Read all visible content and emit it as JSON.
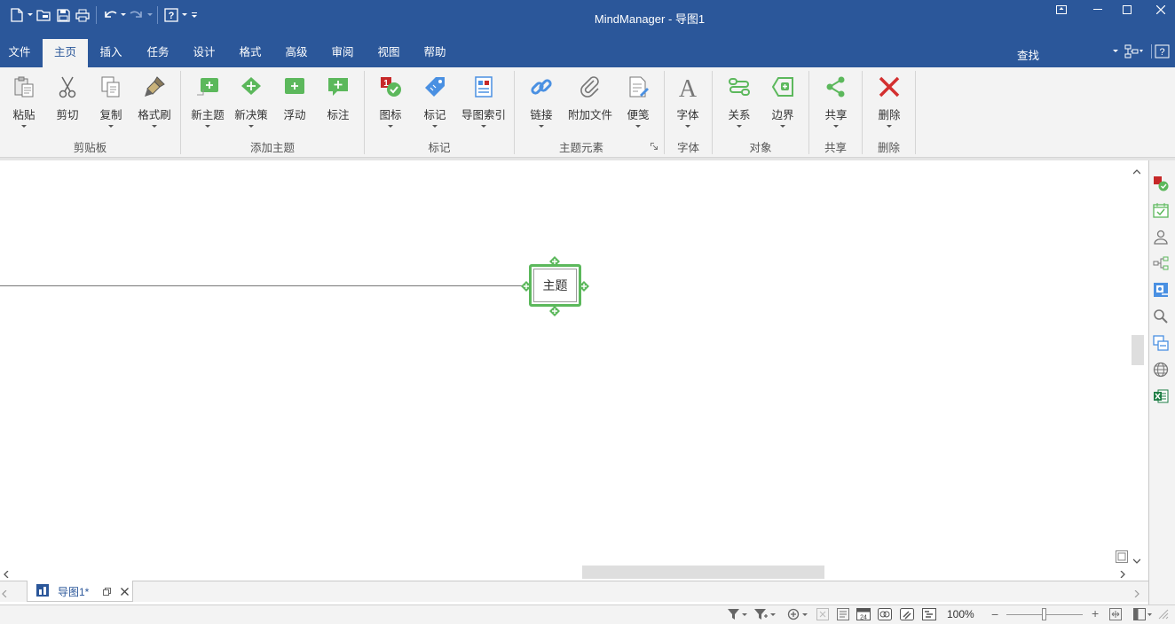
{
  "app": {
    "title": "MindManager - 导图1"
  },
  "quick_access": {
    "icons": [
      "new-doc-icon",
      "open-icon",
      "save-icon",
      "print-icon",
      "undo-icon",
      "redo-icon",
      "help-icon",
      "customize-icon"
    ]
  },
  "tabs": [
    {
      "label": "文件"
    },
    {
      "label": "主页",
      "active": true
    },
    {
      "label": "插入"
    },
    {
      "label": "任务"
    },
    {
      "label": "设计"
    },
    {
      "label": "格式"
    },
    {
      "label": "高级"
    },
    {
      "label": "审阅"
    },
    {
      "label": "视图"
    },
    {
      "label": "帮助"
    }
  ],
  "search": {
    "label": "查找"
  },
  "ribbon": {
    "groups": [
      {
        "label": "剪贴板",
        "buttons": [
          "粘贴",
          "剪切",
          "复制",
          "格式刷"
        ]
      },
      {
        "label": "添加主题",
        "buttons": [
          "新主题",
          "新决策",
          "浮动",
          "标注"
        ]
      },
      {
        "label": "标记",
        "buttons": [
          "图标",
          "标记",
          "导图索引"
        ]
      },
      {
        "label": "主题元素",
        "buttons": [
          "链接",
          "附加文件",
          "便笺"
        ]
      },
      {
        "label": "字体",
        "buttons": [
          "字体"
        ]
      },
      {
        "label": "对象",
        "buttons": [
          "关系",
          "边界"
        ]
      },
      {
        "label": "共享",
        "buttons": [
          "共享"
        ]
      },
      {
        "label": "删除",
        "buttons": [
          "删除"
        ]
      }
    ]
  },
  "canvas": {
    "central_topic": "主题"
  },
  "document_tab": {
    "label": "导图1*"
  },
  "status": {
    "zoom": "100%",
    "zoom_level": 0.5
  },
  "colors": {
    "brand": "#2b579a",
    "topic_border": "#5cb85c",
    "delete_red": "#d32f2f"
  }
}
